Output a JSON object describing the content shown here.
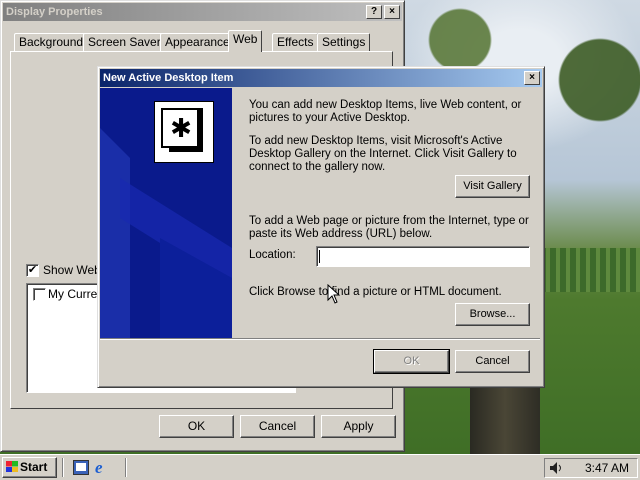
{
  "display_properties": {
    "title": "Display Properties",
    "help_label": "?",
    "close_label": "×",
    "tabs": [
      {
        "label": "Background"
      },
      {
        "label": "Screen Saver"
      },
      {
        "label": "Appearance"
      },
      {
        "label": "Web",
        "selected": true
      },
      {
        "label": "Effects"
      },
      {
        "label": "Settings"
      }
    ],
    "show_web_label": "Show Web",
    "show_web_checked": true,
    "list_item_label": "My Current",
    "list_item_checked": false,
    "ok_label": "OK",
    "cancel_label": "Cancel",
    "apply_label": "Apply"
  },
  "dialog": {
    "title": "New Active Desktop Item",
    "close_label": "×",
    "intro_text": "You can add new Desktop Items, live Web content, or pictures to your Active Desktop.",
    "gallery_text": "To add new Desktop Items, visit Microsoft's Active Desktop Gallery on the Internet. Click Visit Gallery to connect to the gallery now.",
    "visit_gallery_label": "Visit Gallery",
    "url_text": "To add a Web page or picture from the Internet, type or paste its Web address (URL) below.",
    "location_label": "Location:",
    "location_value": "",
    "browse_text": "Click Browse to find a picture or HTML document.",
    "browse_label": "Browse...",
    "ok_label": "OK",
    "cancel_label": "Cancel"
  },
  "taskbar": {
    "start_label": "Start",
    "clock": "3:47 AM"
  },
  "colors": {
    "active_title": "#0a246a",
    "inactive_title": "#808080",
    "face": "#d4d0c8",
    "banner_blue": "#0a1a8c"
  }
}
